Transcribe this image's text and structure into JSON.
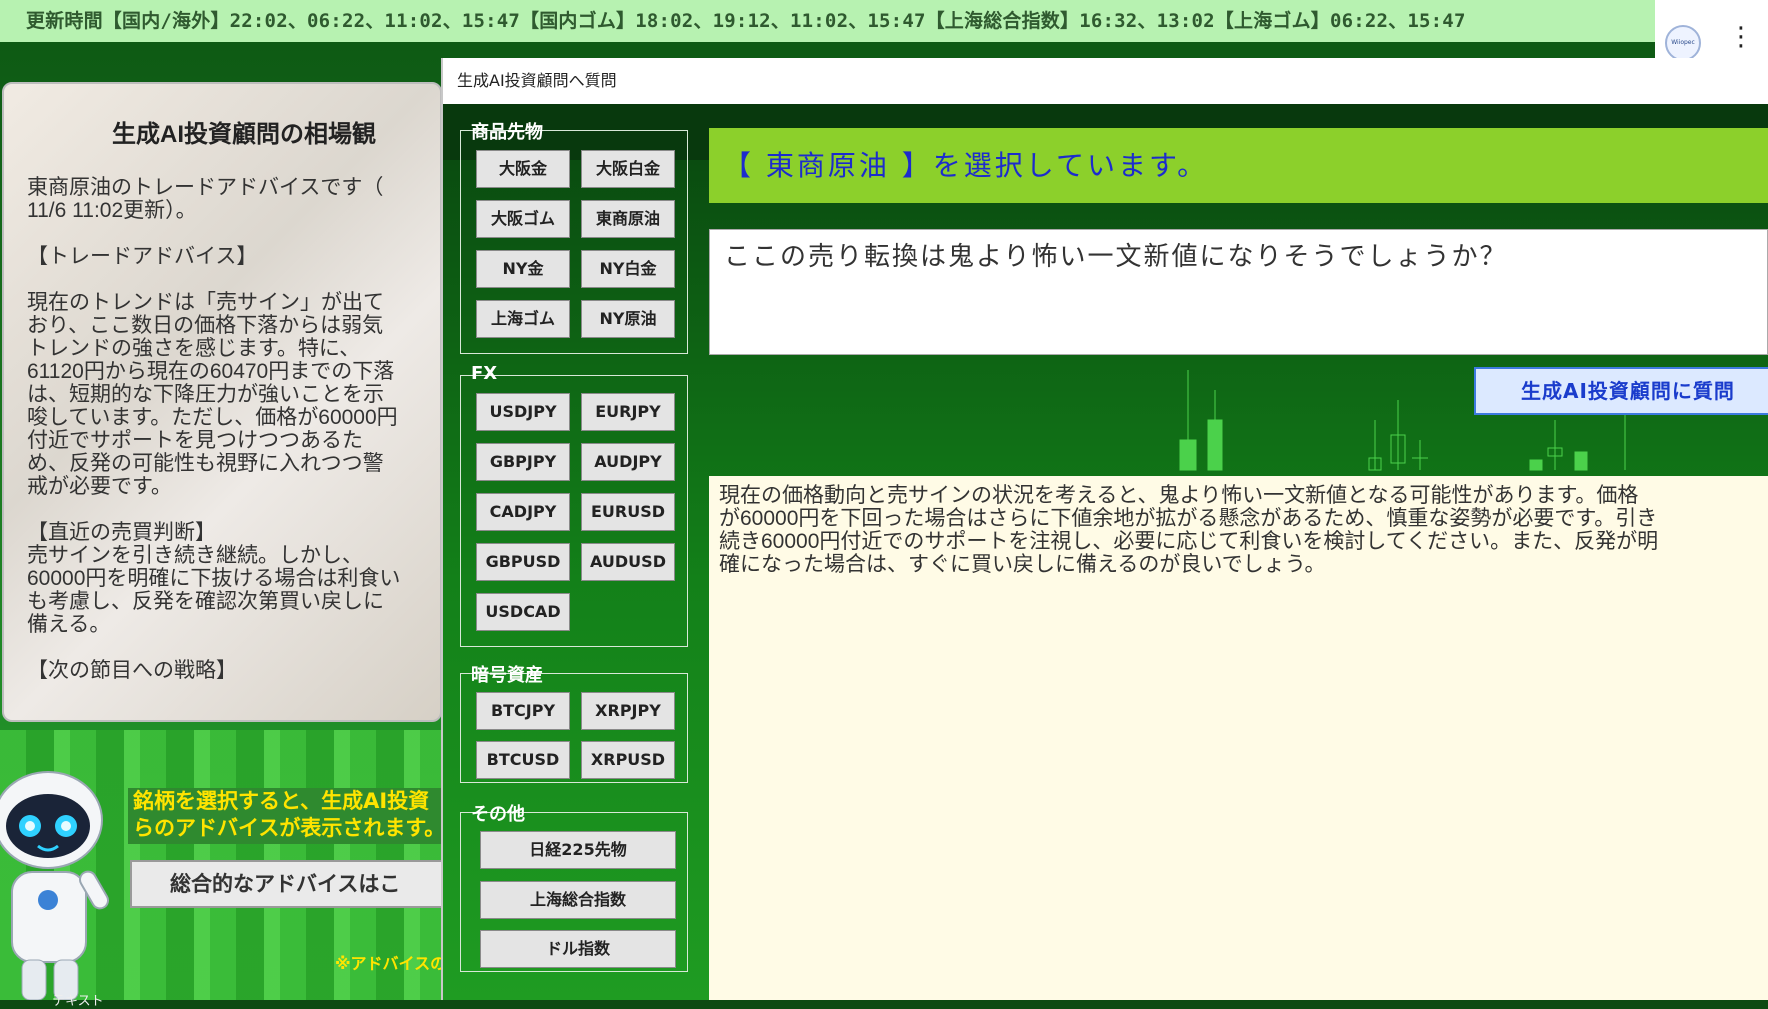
{
  "ticker": {
    "text": "更新時間【国内/海外】22:02、06:22、11:02、15:47【国内ゴム】18:02、19:12、11:02、15:47【上海総合指数】16:32、13:02【上海ゴム】06:22、15:47"
  },
  "header_right": {
    "logo_text": "Wiiopec",
    "menu_icon": "kebab-menu-icon"
  },
  "advice_panel": {
    "title": "生成AI投資顧問の相場観",
    "body": "東商原油のトレードアドバイスです（\n11/6 11:02更新）。\n\n【トレードアドバイス】\n\n現在のトレンドは「売サイン」が出て\nおり、ここ数日の価格下落からは弱気\nトレンドの強さを感じます。特に、\n61120円から現在の60470円までの下落\nは、短期的な下降圧力が強いことを示\n唆しています。ただし、価格が60000円\n付近でサポートを見つけつつあるた\nめ、反発の可能性も視野に入れつつ警\n戒が必要です。\n\n【直近の売買判断】\n売サインを引き続き継続。しかし、\n60000円を明確に下抜ける場合は利食い\nも考慮し、反発を確認次第買い戻しに\n備える。\n\n【次の節目への戦略】"
  },
  "left_bottom": {
    "message_line1": "銘柄を選択すると、生成AI投資",
    "message_line2": "らのアドバイスが表示されます。",
    "overall_button": "総合的なアドバイスはこ",
    "note": "※アドバイスの",
    "bottom_label": "テキスト"
  },
  "dialog": {
    "title": "生成AI投資顧問へ質問",
    "groups": {
      "commodities": {
        "label": "商品先物",
        "buttons": [
          "大阪金",
          "大阪白金",
          "大阪ゴム",
          "東商原油",
          "NY金",
          "NY白金",
          "上海ゴム",
          "NY原油"
        ]
      },
      "fx": {
        "label": "FX",
        "buttons": [
          "USDJPY",
          "EURJPY",
          "GBPJPY",
          "AUDJPY",
          "CADJPY",
          "EURUSD",
          "GBPUSD",
          "AUDUSD",
          "USDCAD"
        ]
      },
      "crypto": {
        "label": "暗号資産",
        "buttons": [
          "BTCJPY",
          "XRPJPY",
          "BTCUSD",
          "XRPUSD"
        ]
      },
      "other": {
        "label": "その他",
        "buttons": [
          "日経225先物",
          "上海総合指数",
          "ドル指数"
        ]
      }
    },
    "selected_text": "【 東商原油 】を選択しています。",
    "question": "ここの売り転換は鬼より怖い一文新値になりそうでしょうか？",
    "ask_button": "生成AI投資顧問に質問",
    "answer": "現在の価格動向と売サインの状況を考えると、鬼より怖い一文新値となる可能性があります。価格\nが60000円を下回った場合はさらに下値余地が拡がる懸念があるため、慎重な姿勢が必要です。引き\n続き60000円付近でのサポートを注視し、必要に応じて利食いを検討してください。また、反発が明\n確になった場合は、すぐに買い戻しに備えるのが良いでしょう。"
  },
  "colors": {
    "ticker_bg": "#b7f2b1",
    "selected_bar_bg": "#8cd02b",
    "selected_text": "#1c2ccd",
    "ask_button_text": "#1a3ccc",
    "answer_bg": "#fffbe6",
    "message_text": "#ffe400"
  }
}
